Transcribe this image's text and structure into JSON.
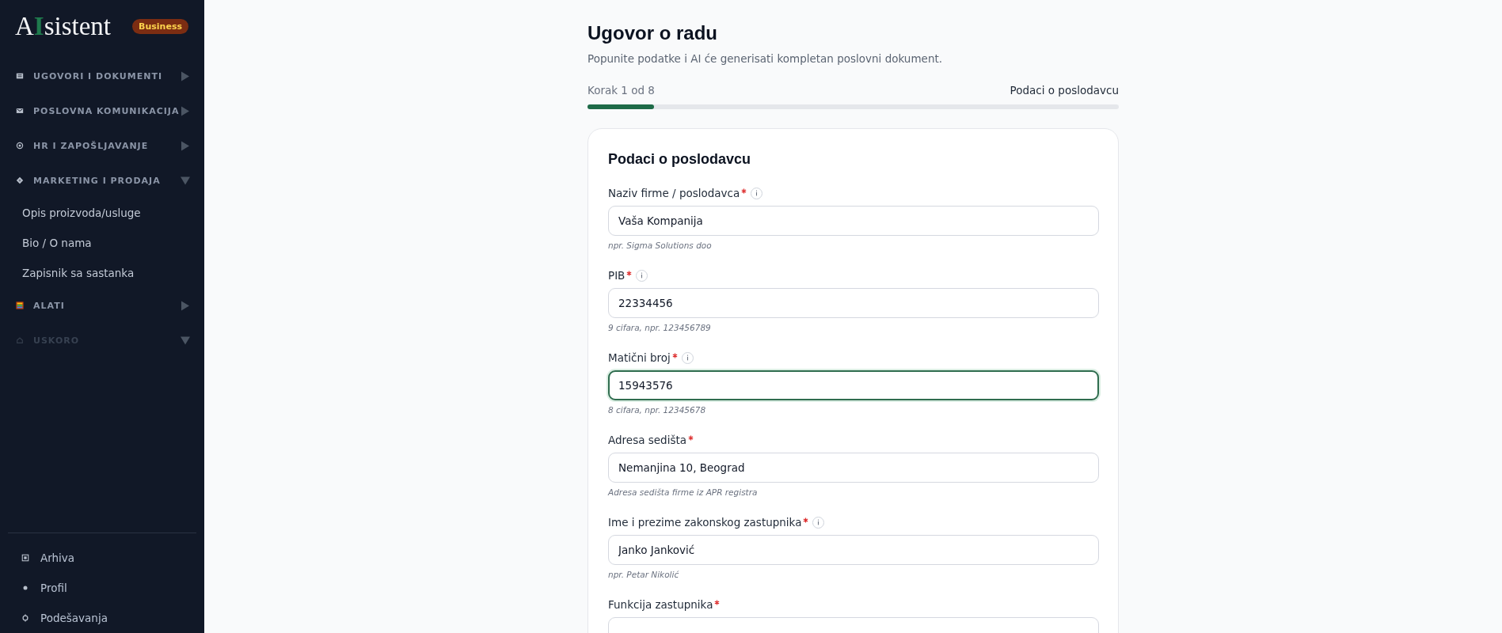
{
  "sidebar": {
    "logo": {
      "before": "A",
      "accent": "I",
      "after": "sistent"
    },
    "plan_badge": "Business",
    "categories": [
      {
        "label": "UGOVORI I DOKUMENTI",
        "expanded": false,
        "disabled": false
      },
      {
        "label": "POSLOVNA KOMUNIKACIJA",
        "expanded": false,
        "disabled": false
      },
      {
        "label": "HR I ZAPOŠLJAVANJE",
        "expanded": false,
        "disabled": false
      },
      {
        "label": "MARKETING I PRODAJA",
        "expanded": true,
        "disabled": false,
        "children": [
          {
            "label": "Opis proizvoda/usluge"
          },
          {
            "label": "Bio / O nama"
          },
          {
            "label": "Zapisnik sa sastanka"
          }
        ]
      },
      {
        "label": "ALATI",
        "expanded": false,
        "disabled": false
      },
      {
        "label": "USKORO",
        "expanded": true,
        "disabled": true
      }
    ],
    "bottom_items": [
      {
        "label": "Arhiva"
      },
      {
        "label": "Profil"
      },
      {
        "label": "Podešavanja"
      }
    ]
  },
  "page": {
    "title": "Ugovor o radu",
    "subtitle": "Popunite podatke i AI će generisati kompletan poslovni dokument.",
    "step": "Korak 1 od 8",
    "step_name": "Podaci o poslodavcu",
    "progress": {
      "level": 0.125
    }
  },
  "form": {
    "title": "Podaci o poslodavcu",
    "fields": [
      {
        "label": "Naziv firme / poslodavca",
        "required": true,
        "info": true,
        "value": "Vaša Kompanija",
        "hint": "npr. Sigma Solutions doo",
        "focused": false
      },
      {
        "label": "PIB",
        "required": true,
        "info": true,
        "value": "22334456",
        "hint": "9 cifara, npr. 123456789",
        "focused": false
      },
      {
        "label": "Matični broj",
        "required": true,
        "info": true,
        "value": "15943576",
        "hint": "8 cifara, npr. 12345678",
        "focused": true
      },
      {
        "label": "Adresa sedišta",
        "required": true,
        "info": false,
        "value": "Nemanjina 10, Beograd",
        "hint": "Adresa sedišta firme iz APR registra",
        "focused": false
      },
      {
        "label": "Ime i prezime zakonskog zastupnika",
        "required": true,
        "info": true,
        "value": "Janko Janković",
        "hint": "npr. Petar Nikolić",
        "focused": false
      },
      {
        "label": "Funkcija zastupnika",
        "required": true,
        "info": false,
        "focused": false
      }
    ]
  }
}
